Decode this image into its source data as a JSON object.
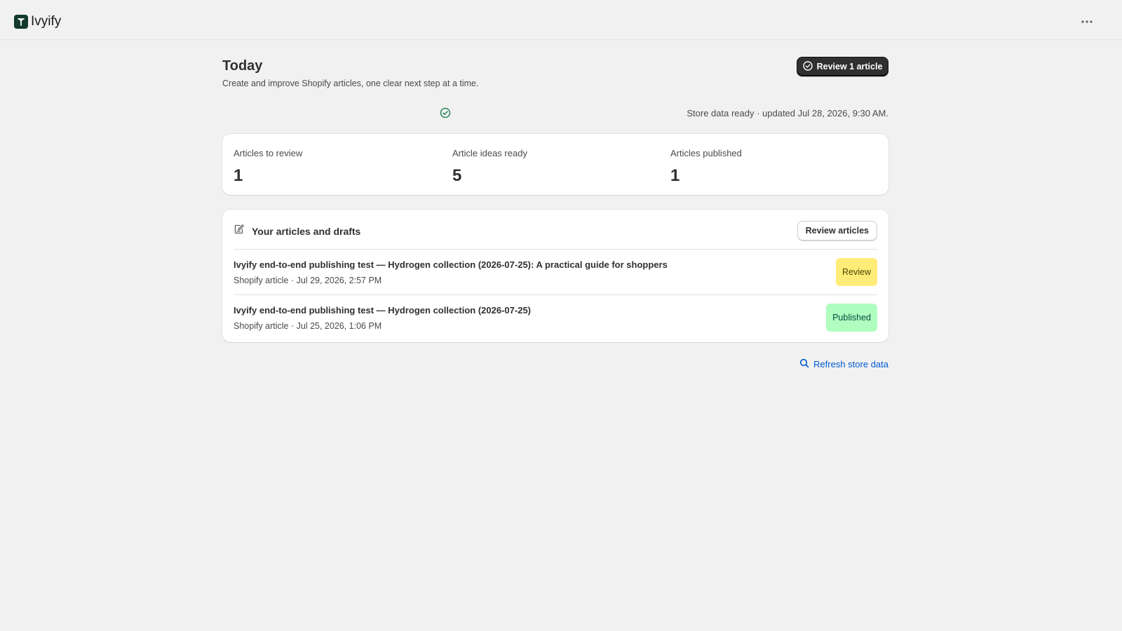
{
  "app": {
    "name": "Ivyify",
    "more_icon": "ellipsis-horizontal-icon",
    "logo_icon": "ivyify-logo-icon"
  },
  "header": {
    "title": "Today",
    "subtitle": "Create and improve Shopify articles, one clear next step at a time.",
    "primary_action": "Review 1 article",
    "primary_action_icon": "check-circle-icon"
  },
  "status": {
    "icon": "check-circle-icon",
    "text": "Store data ready · updated Jul 28, 2026, 9:30 AM."
  },
  "stats": [
    {
      "label": "Articles to review",
      "value": "1"
    },
    {
      "label": "Article ideas ready",
      "value": "5"
    },
    {
      "label": "Articles published",
      "value": "1"
    }
  ],
  "articles_card": {
    "icon": "edit-document-icon",
    "title": "Your articles and drafts",
    "action": "Review articles",
    "items": [
      {
        "title": "Ivyify end-to-end publishing test — Hydrogen collection (2026-07-25): A practical guide for shoppers",
        "meta": "Shopify article · Jul 29, 2026, 2:57 PM",
        "badge": "Review"
      },
      {
        "title": "Ivyify end-to-end publishing test — Hydrogen collection (2026-07-25)",
        "meta": "Shopify article · Jul 25, 2026, 1:06 PM",
        "badge": "Published"
      }
    ]
  },
  "footer": {
    "refresh_label": "Refresh store data",
    "refresh_icon": "search-icon"
  },
  "colors": {
    "background": "#f1f1f1",
    "primary_button": "#303030",
    "success_icon": "#29845a",
    "review_badge": "#ffeb78",
    "published_badge": "#affebf",
    "link": "#005bd3"
  }
}
